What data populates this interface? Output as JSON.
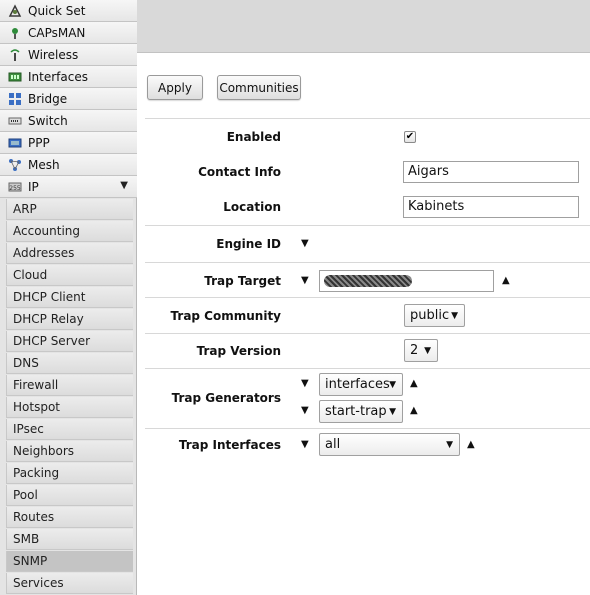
{
  "sidebar": {
    "menu": [
      {
        "label": "Quick Set",
        "icon": "quick-set-icon"
      },
      {
        "label": "CAPsMAN",
        "icon": "capsman-icon"
      },
      {
        "label": "Wireless",
        "icon": "wireless-icon"
      },
      {
        "label": "Interfaces",
        "icon": "interfaces-icon"
      },
      {
        "label": "Bridge",
        "icon": "bridge-icon"
      },
      {
        "label": "Switch",
        "icon": "switch-icon"
      },
      {
        "label": "PPP",
        "icon": "ppp-icon"
      },
      {
        "label": "Mesh",
        "icon": "mesh-icon"
      },
      {
        "label": "IP",
        "icon": "ip-icon",
        "expanded": true
      }
    ],
    "ip_submenu": [
      "ARP",
      "Accounting",
      "Addresses",
      "Cloud",
      "DHCP Client",
      "DHCP Relay",
      "DHCP Server",
      "DNS",
      "Firewall",
      "Hotspot",
      "IPsec",
      "Neighbors",
      "Packing",
      "Pool",
      "Routes",
      "SMB",
      "SNMP",
      "Services"
    ],
    "active_submenu": "SNMP"
  },
  "toolbar": {
    "apply_label": "Apply",
    "communities_label": "Communities"
  },
  "form": {
    "enabled_label": "Enabled",
    "enabled_checked": true,
    "contact_info_label": "Contact Info",
    "contact_info_value": "Aigars",
    "location_label": "Location",
    "location_value": "Kabinets",
    "engine_id_label": "Engine ID",
    "trap_target_label": "Trap Target",
    "trap_community_label": "Trap Community",
    "trap_community_value": "public",
    "trap_version_label": "Trap Version",
    "trap_version_value": "2",
    "trap_generators_label": "Trap Generators",
    "trap_generators_values": [
      "interfaces",
      "start-trap"
    ],
    "trap_interfaces_label": "Trap Interfaces",
    "trap_interfaces_value": "all"
  },
  "colors": {
    "header_bg": "#d9d9d9",
    "sidebar_bg": "#e4e4e4",
    "active_item_bg": "#c4c4c4"
  }
}
